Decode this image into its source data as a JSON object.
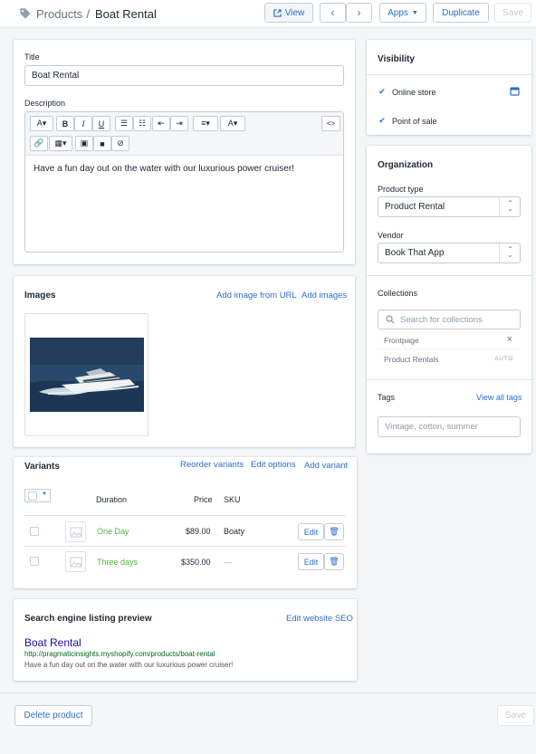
{
  "header": {
    "breadcrumb_parent": "Products",
    "separator": "/",
    "title": "Boat Rental",
    "view_label": "View",
    "apps_label": "Apps",
    "duplicate_label": "Duplicate",
    "save_label": "Save"
  },
  "product": {
    "title_label": "Title",
    "title_value": "Boat Rental",
    "description_label": "Description",
    "description_text": "Have a fun day out on the water with our luxurious power cruiser!",
    "html_toggle": "<>"
  },
  "images": {
    "heading": "Images",
    "add_from_url": "Add image from URL",
    "add_images": "Add images"
  },
  "variants": {
    "heading": "Variants",
    "reorder": "Reorder variants",
    "edit_options": "Edit options",
    "add_variant": "Add variant",
    "columns": {
      "duration": "Duration",
      "price": "Price",
      "sku": "SKU"
    },
    "rows": [
      {
        "duration": "One Day",
        "price": "$89.00",
        "sku": "Boaty",
        "edit": "Edit"
      },
      {
        "duration": "Three days",
        "price": "$350.00",
        "sku": "—",
        "edit": "Edit"
      }
    ]
  },
  "seo": {
    "heading": "Search engine listing preview",
    "edit_link": "Edit website SEO",
    "preview_title": "Boat Rental",
    "preview_url": "http://pragmaticinsights.myshopify.com/products/boat-rental",
    "preview_desc": "Have a fun day out on the water with our luxurious power cruiser!"
  },
  "visibility": {
    "heading": "Visibility",
    "channels": [
      "Online store",
      "Point of sale"
    ]
  },
  "organization": {
    "heading": "Organization",
    "product_type_label": "Product type",
    "product_type_value": "Product Rental",
    "vendor_label": "Vendor",
    "vendor_value": "Book That App",
    "collections_label": "Collections",
    "collections_placeholder": "Search for collections",
    "collections": [
      {
        "name": "Frontpage",
        "meta": "×"
      },
      {
        "name": "Product Rentals",
        "meta": "AUTO"
      }
    ],
    "tags_label": "Tags",
    "view_all_tags": "View all tags",
    "tags_placeholder": "Vintage, cotton, summer"
  },
  "footer": {
    "delete_label": "Delete product",
    "save_label": "Save"
  },
  "colors": {
    "accent": "#2c6ecb",
    "green": "#50b83c",
    "border": "#c4cdd5"
  }
}
